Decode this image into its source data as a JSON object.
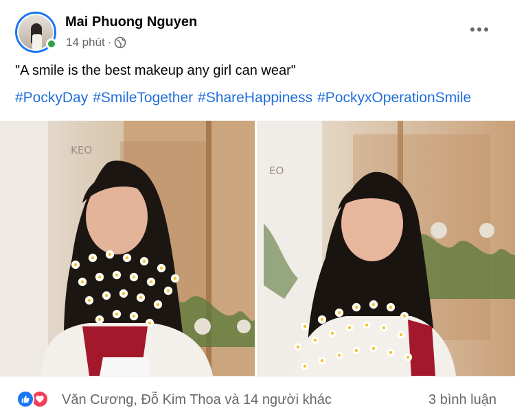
{
  "post": {
    "author": "Mai Phuong Nguyen",
    "time": "14 phút",
    "separator": "·",
    "caption": "\"A smile is the best makeup any girl can wear\"",
    "hashtags": [
      "#PockyDay",
      "#SmileTogether",
      "#ShareHappiness",
      "#PockyxOperationSmile"
    ],
    "photos": [
      {
        "sign_text": "KEO"
      },
      {
        "sign_text": "EO"
      }
    ]
  },
  "footer": {
    "reactors": "Văn Cương, Đỗ Kim Thoa và 14 người khác",
    "comments": "3 bình luận"
  },
  "icons": {
    "like": "like-icon",
    "love": "love-icon",
    "privacy": "globe-icon",
    "more": "more-icon"
  },
  "colors": {
    "accent": "#1877f2",
    "hashtag": "#216fdb",
    "online": "#31a24c",
    "love": "#f33e58",
    "muted": "#65676b"
  }
}
